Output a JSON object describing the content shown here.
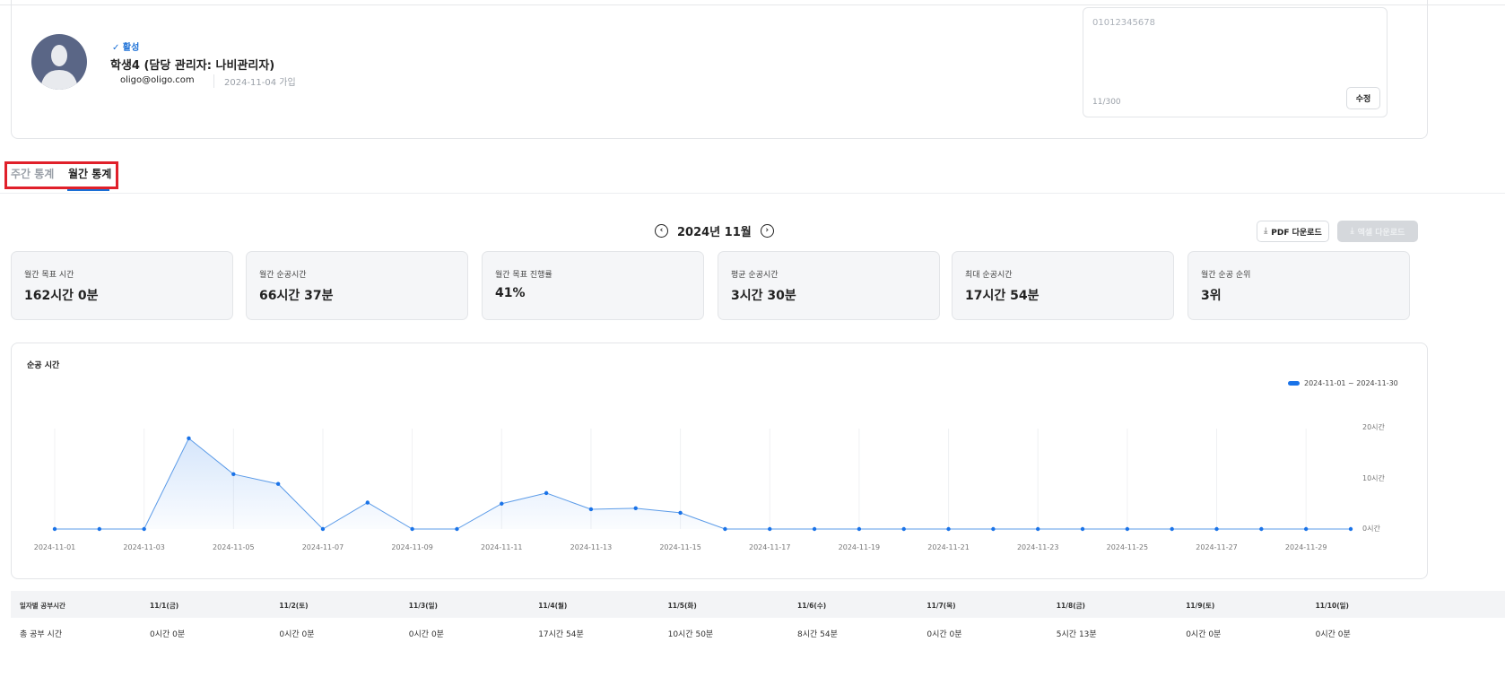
{
  "profile": {
    "status": "활성",
    "name": "학생4 (담당 관리자: 나비관리자)",
    "email": "oligo@oligo.com",
    "joined": "2024-11-04 가입",
    "memo_value": "01012345678",
    "memo_count": "11/300",
    "edit_label": "수정"
  },
  "tabs": [
    {
      "label": "주간 통계",
      "active": false
    },
    {
      "label": "월간 통계",
      "active": true
    }
  ],
  "month_nav": {
    "label": "2024년 11월"
  },
  "actions": {
    "pdf_label": "PDF 다운로드",
    "excel_label": "엑셀 다운로드"
  },
  "stats": [
    {
      "label": "월간 목표 시간",
      "value": "162시간 0분"
    },
    {
      "label": "월간 순공시간",
      "value": "66시간 37분"
    },
    {
      "label": "월간 목표 진행률",
      "value": "41%"
    },
    {
      "label": "평균 순공시간",
      "value": "3시간 30분"
    },
    {
      "label": "최대 순공시간",
      "value": "17시간 54분"
    },
    {
      "label": "월간 순공 순위",
      "value": "3위"
    }
  ],
  "chart_data": {
    "type": "area",
    "title": "순공 시간",
    "legend": "2024-11-01 ~ 2024-11-30",
    "legend_position": "top-right",
    "color": "#1a73e8",
    "ylim": [
      0,
      20
    ],
    "yticks": [
      "0시간",
      "10시간",
      "20시간"
    ],
    "xticks": [
      "2024-11-01",
      "2024-11-03",
      "2024-11-05",
      "2024-11-07",
      "2024-11-09",
      "2024-11-11",
      "2024-11-13",
      "2024-11-15",
      "2024-11-17",
      "2024-11-19",
      "2024-11-21",
      "2024-11-23",
      "2024-11-25",
      "2024-11-27",
      "2024-11-29"
    ],
    "x": [
      "2024-11-01",
      "2024-11-02",
      "2024-11-03",
      "2024-11-04",
      "2024-11-05",
      "2024-11-06",
      "2024-11-07",
      "2024-11-08",
      "2024-11-09",
      "2024-11-10",
      "2024-11-11",
      "2024-11-12",
      "2024-11-13",
      "2024-11-14",
      "2024-11-15",
      "2024-11-16",
      "2024-11-17",
      "2024-11-18",
      "2024-11-19",
      "2024-11-20",
      "2024-11-21",
      "2024-11-22",
      "2024-11-23",
      "2024-11-24",
      "2024-11-25",
      "2024-11-26",
      "2024-11-27",
      "2024-11-28",
      "2024-11-29",
      "2024-11-30"
    ],
    "values": [
      0,
      0,
      0,
      17.9,
      10.83,
      8.9,
      0,
      5.22,
      0,
      0,
      5.0,
      7.1,
      3.9,
      4.1,
      3.2,
      0,
      0,
      0,
      0,
      0,
      0,
      0,
      0,
      0,
      0,
      0,
      0,
      0,
      0,
      0
    ]
  },
  "table": {
    "header_label": "일자별 공부시간",
    "row_label": "총 공부 시간",
    "columns": [
      "11/1(금)",
      "11/2(토)",
      "11/3(일)",
      "11/4(월)",
      "11/5(화)",
      "11/6(수)",
      "11/7(목)",
      "11/8(금)",
      "11/9(토)",
      "11/10(일)"
    ],
    "values": [
      "0시간 0분",
      "0시간 0분",
      "0시간 0분",
      "17시간 54분",
      "10시간 50분",
      "8시간 54분",
      "0시간 0분",
      "5시간 13분",
      "0시간 0분",
      "0시간 0분"
    ]
  }
}
